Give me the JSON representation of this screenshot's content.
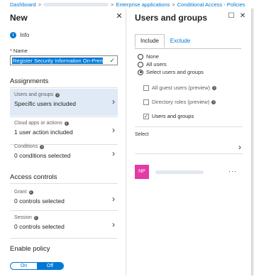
{
  "breadcrumb": {
    "items": [
      "Dashboard",
      "Enterprise applications",
      "Conditional Access - Policies"
    ]
  },
  "left_panel": {
    "title": "New",
    "info_label": "Info",
    "name": {
      "label": "Name",
      "required_mark": "*",
      "value": "Register Security Information On-Premises"
    },
    "assignments_heading": "Assignments",
    "assignments": [
      {
        "title": "Users and groups",
        "value": "Specific users included"
      },
      {
        "title": "Cloud apps or actions",
        "value": "1 user action included"
      },
      {
        "title": "Conditions",
        "value": "0 conditions selected"
      }
    ],
    "access_heading": "Access controls",
    "access_controls": [
      {
        "title": "Grant",
        "value": "0 controls selected"
      },
      {
        "title": "Session",
        "value": "0 controls selected"
      }
    ],
    "enable_policy": {
      "label": "Enable policy",
      "on_label": "On",
      "off_label": "Off",
      "selected": "Off"
    }
  },
  "right_panel": {
    "title": "Users and groups",
    "tabs": [
      "Include",
      "Exclude"
    ],
    "active_tab": "Include",
    "radios": [
      {
        "label": "None",
        "checked": false
      },
      {
        "label": "All users",
        "checked": false
      },
      {
        "label": "Select users and groups",
        "checked": true
      }
    ],
    "checkboxes": [
      {
        "label": "All guest users (preview)",
        "checked": false
      },
      {
        "label": "Directory roles (preview)",
        "checked": false
      },
      {
        "label": "Users and groups",
        "checked": true
      }
    ],
    "select_label": "Select",
    "selected_user": {
      "initials": "NP"
    }
  },
  "colors": {
    "accent": "#0078d4",
    "avatar": "#e43ba6",
    "selected_nav": "#dfeaf6"
  }
}
